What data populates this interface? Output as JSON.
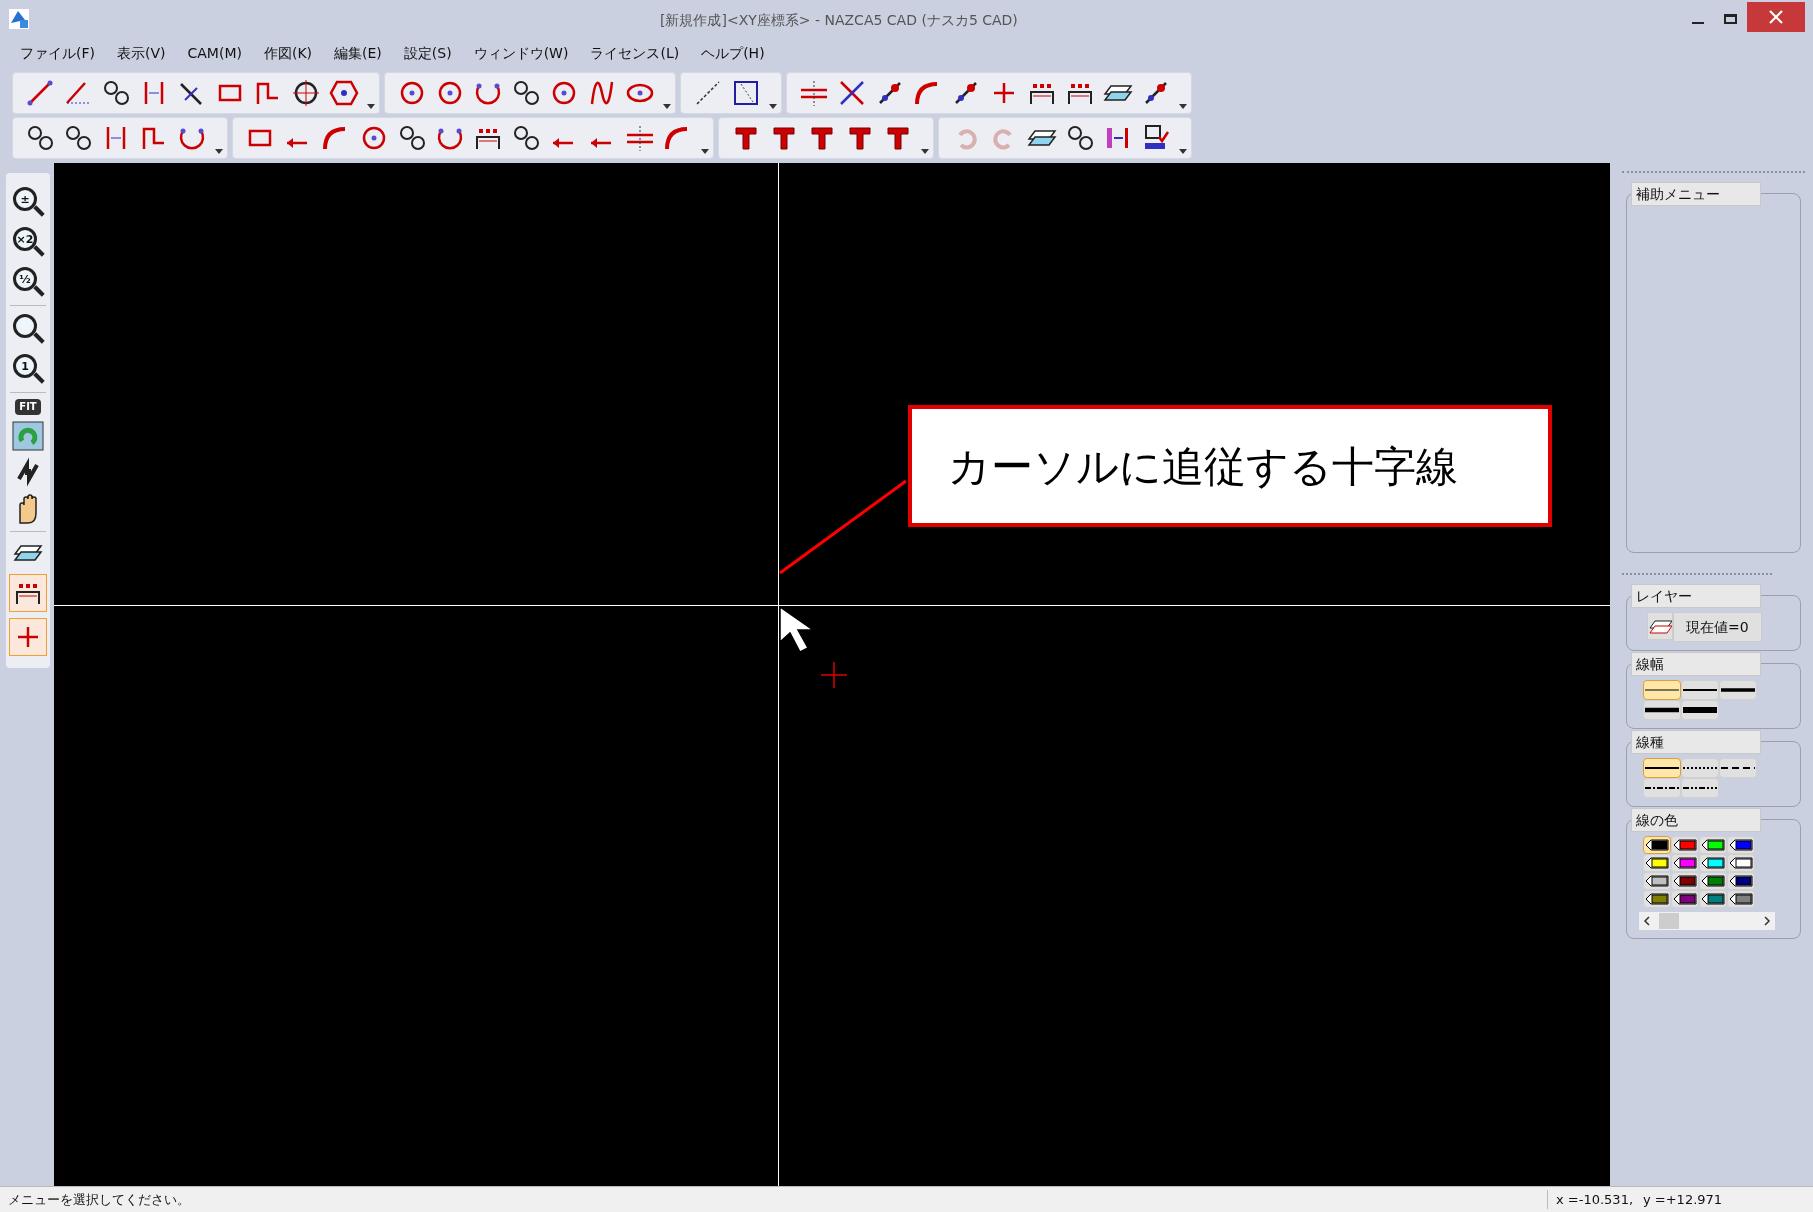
{
  "window": {
    "title": "[新規作成]<XY座標系> - NAZCA5 CAD (ナスカ5 CAD)"
  },
  "menu": [
    "ファイル(F)",
    "表示(V)",
    "CAM(M)",
    "作図(K)",
    "編集(E)",
    "設定(S)",
    "ウィンドウ(W)",
    "ライセンス(L)",
    "ヘルプ(H)"
  ],
  "left_toolbar": [
    {
      "glyph": "±"
    },
    {
      "glyph": "×2"
    },
    {
      "glyph": "½"
    },
    {
      "glyph": "1"
    },
    {
      "glyph": "FIT"
    }
  ],
  "annotation": {
    "text": "カーソルに追従する十字線"
  },
  "side_panel": {
    "aux_menu_title": "補助メニュー",
    "layer_title": "レイヤー",
    "layer_value": "現在値=0",
    "width_title": "線幅",
    "widths": [
      {
        "selected": true
      },
      {
        "selected": false
      },
      {
        "selected": false
      },
      {
        "selected": false
      },
      {
        "selected": false
      }
    ],
    "type_title": "線種",
    "types": [
      {
        "kind": "solid",
        "selected": true
      },
      {
        "kind": "dotted",
        "selected": false
      },
      {
        "kind": "dashed",
        "selected": false
      },
      {
        "kind": "dashdot",
        "selected": false
      },
      {
        "kind": "dashdotdot",
        "selected": false
      }
    ],
    "color_title": "線の色",
    "colors": [
      {
        "color": "#000000",
        "selected": true
      },
      {
        "color": "#ff0000",
        "selected": false
      },
      {
        "color": "#00ff00",
        "selected": false
      },
      {
        "color": "#0000ff",
        "selected": false
      },
      {
        "color": "#ffff00",
        "selected": false
      },
      {
        "color": "#ff00ff",
        "selected": false
      },
      {
        "color": "#00ffff",
        "selected": false
      },
      {
        "color": "#ffffff",
        "selected": false
      },
      {
        "color": "#c0c0c0",
        "selected": false
      },
      {
        "color": "#800000",
        "selected": false
      },
      {
        "color": "#008000",
        "selected": false
      },
      {
        "color": "#000080",
        "selected": false
      },
      {
        "color": "#808000",
        "selected": false
      },
      {
        "color": "#800080",
        "selected": false
      },
      {
        "color": "#008080",
        "selected": false
      },
      {
        "color": "#808080",
        "selected": false
      }
    ]
  },
  "status_bar": {
    "message": "メニューを選択してください。",
    "x": "x =-10.531,",
    "y": "y =+12.971"
  }
}
